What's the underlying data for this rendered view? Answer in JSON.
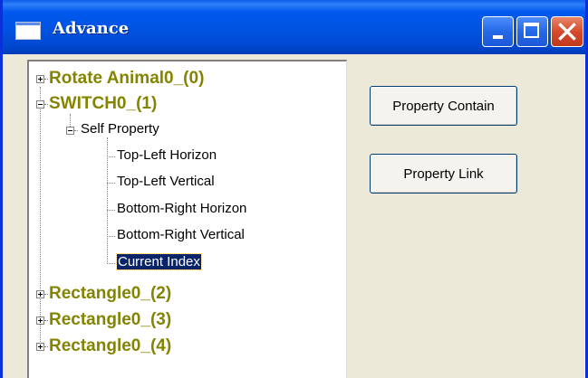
{
  "window": {
    "title": "Advance"
  },
  "tree": {
    "nodes": [
      {
        "label": "Rotate Animal0_(0)"
      },
      {
        "label": "SWITCH0_(1)"
      },
      {
        "label": "Self Property"
      },
      {
        "label": "Top-Left Horizon"
      },
      {
        "label": "Top-Left Vertical"
      },
      {
        "label": "Bottom-Right Horizon"
      },
      {
        "label": "Bottom-Right Vertical"
      },
      {
        "label": "Current Index"
      },
      {
        "label": "Rectangle0_(2)"
      },
      {
        "label": "Rectangle0_(3)"
      },
      {
        "label": "Rectangle0_(4)"
      }
    ],
    "selected": "Current Index"
  },
  "buttons": {
    "property_contain": "Property Contain",
    "property_link": "Property Link"
  },
  "icons": {
    "app": "window-icon",
    "minimize": "minimize-icon",
    "maximize": "maximize-icon",
    "close": "close-icon",
    "expand": "plus-box-icon",
    "collapse": "minus-box-icon"
  },
  "colors": {
    "titlebar": "#0054e3",
    "close_button": "#d64a2b",
    "node_label": "#848400",
    "selection": "#0a246a"
  }
}
